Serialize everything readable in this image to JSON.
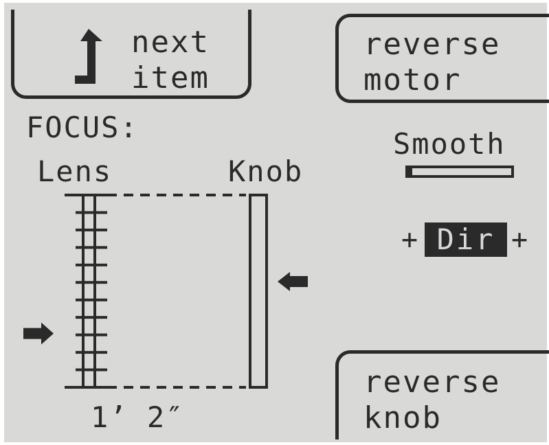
{
  "softkeys": {
    "next_item": {
      "line1": "next",
      "line2": "item",
      "icon": "up-turn-arrow-icon"
    },
    "reverse_motor": {
      "line1": "reverse",
      "line2": "motor"
    },
    "reverse_knob": {
      "line1": "reverse",
      "line2": "knob"
    }
  },
  "focus": {
    "heading": "FOCUS:",
    "lens_label": "Lens",
    "knob_label": "Knob",
    "distance": "1’ 2″",
    "lens_marker_icon": "right-arrow-marker-icon",
    "knob_marker_icon": "left-arrow-marker-icon",
    "lens_level": 0.72,
    "knob_level": 0.45
  },
  "smooth": {
    "label": "Smooth",
    "level": 0.03
  },
  "direction": {
    "label": "Dir",
    "left_sign": "+",
    "right_sign": "+"
  },
  "colors": {
    "lcd_background": "#d9d9d7",
    "pixel_dark": "#2a2a2a"
  }
}
